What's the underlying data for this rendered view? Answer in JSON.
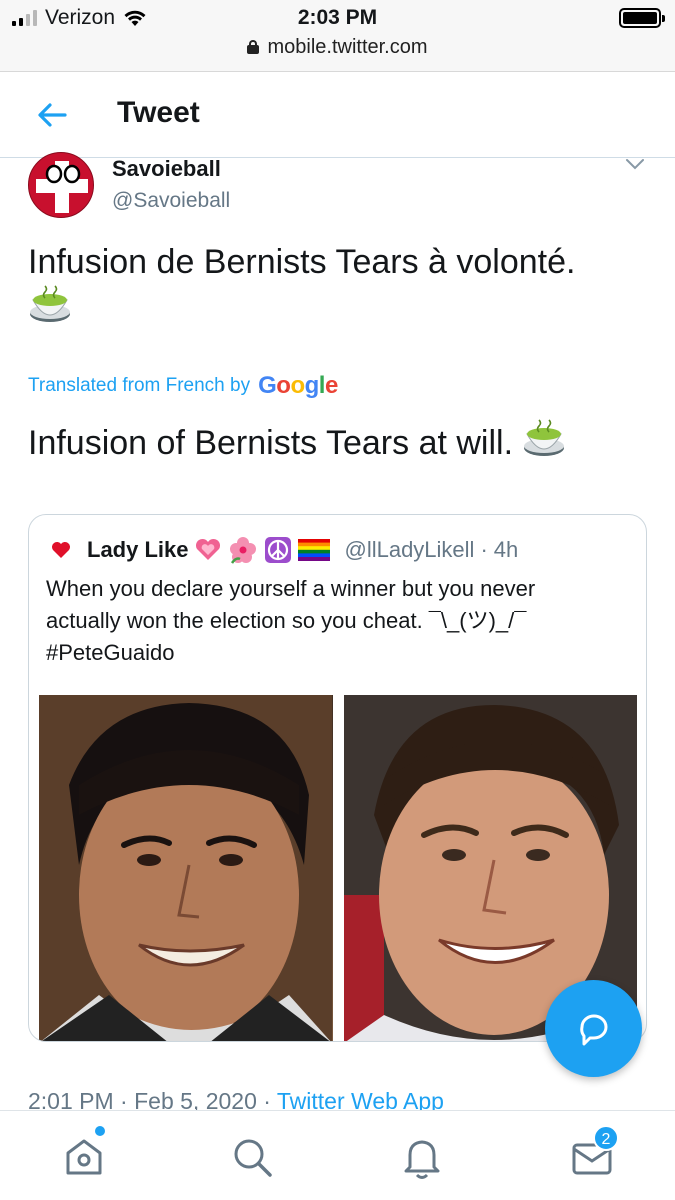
{
  "status_bar": {
    "carrier": "Verizon",
    "time": "2:03 PM",
    "url": "mobile.twitter.com",
    "signal_bars_filled": 2,
    "signal_bars_total": 4
  },
  "header": {
    "title": "Tweet",
    "back_icon": "arrow-left-icon"
  },
  "tweet": {
    "author_name": "Savoieball",
    "author_handle": "@Savoieball",
    "text": "Infusion de Bernists Tears à volonté.",
    "translated_label": "Translated from French by",
    "translation_provider": "Google",
    "translation": "Infusion of Bernists Tears at will.",
    "timestamp": "2:01 PM",
    "date": "Feb 5, 2020",
    "app": "Twitter Web App",
    "meta_separator": " · "
  },
  "quoted_tweet": {
    "author_name": "Lady Like",
    "handle": "@llLadyLikell",
    "time": "4h",
    "separator": " · ",
    "text_line1": "When you declare yourself a winner but you never",
    "text_line2": "actually won the election so you cheat.  ¯\\_(ツ)_/¯",
    "hashtag": "#PeteGuaido"
  },
  "bottom_nav": {
    "messages_badge": "2"
  },
  "colors": {
    "accent": "#1da1f2",
    "secondary_text": "#657786",
    "border": "#ccd6dd"
  }
}
